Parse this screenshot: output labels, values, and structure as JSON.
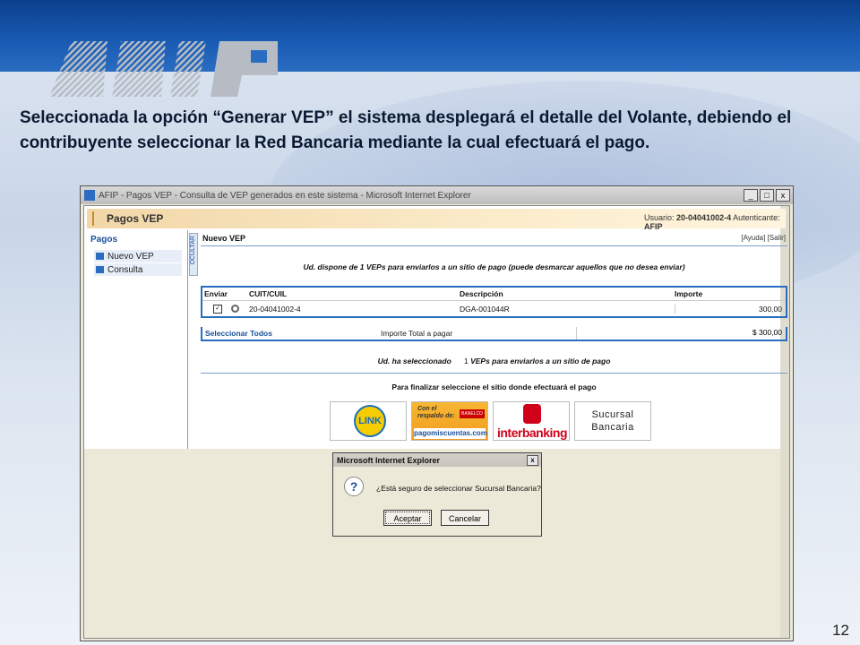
{
  "logo_text": "AFIP",
  "headline": "Seleccionada la opción “Generar VEP” el sistema desplegará el detalle del Volante, debiendo el contribuyente seleccionar la Red Bancaria mediante la cual efectuará el pago.",
  "page_number": "12",
  "ie_window": {
    "title": "AFIP - Pagos VEP - Consulta de VEP generados en este sistema - Microsoft Internet Explorer",
    "min": "_",
    "max": "□",
    "close": "x"
  },
  "app": {
    "title": "Pagos VEP",
    "usuario_label": "Usuario:",
    "usuario_value": "20-04041002-4",
    "autenticante_label": "Autenticante:",
    "autenticante_value": "AFIP"
  },
  "sidebar": {
    "title": "Pagos",
    "items": [
      {
        "label": "Nuevo VEP"
      },
      {
        "label": "Consulta"
      }
    ],
    "ocultar": "OCULTAR"
  },
  "main": {
    "title": "Nuevo VEP",
    "links": "[Ayuda]  [Salir]",
    "dispone": "Ud. dispone de 1 VEPs para enviarlos a un sitio de pago (puede desmarcar aquellos que no desea enviar)",
    "table": {
      "headers": [
        "Enviar",
        "CUIT/CUIL",
        "Descripción",
        "Importe"
      ],
      "rows": [
        {
          "cuit": "20-04041002-4",
          "descripcion": "DGA-001044R",
          "importe": "300,00"
        }
      ]
    },
    "seleccionar_todos": "Seleccionar Todos",
    "importe_total_label": "Importe Total a pagar",
    "importe_total_value": "$ 300,00",
    "seleccionado_label": "Ud. ha seleccionado",
    "seleccionado_count": "1",
    "seleccionado_suffix": "VEPs para enviarlos a un sitio de pago",
    "finalizar": "Para finalizar seleccione el sitio donde efectuará el pago",
    "payment_sites": {
      "link": "LINK",
      "pmc_line1": "Con el",
      "pmc_line2": "respaldo de:",
      "pmc_bank": "BANELCO",
      "pmc_name": "pagomiscuentas.com",
      "interbanking_a": "inter",
      "interbanking_b": "banking",
      "sucursal_1": "Sucursal",
      "sucursal_2": "Bancaria"
    }
  },
  "dialog": {
    "title": "Microsoft Internet Explorer",
    "close": "x",
    "message": "¿Está seguro de seleccionar Sucursal Bancaria?",
    "ok": "Aceptar",
    "cancel": "Cancelar"
  },
  "colors": {
    "afip_blue": "#1a5cb4",
    "link_yellow": "#f5cd00",
    "interbanking_red": "#d0021b"
  }
}
